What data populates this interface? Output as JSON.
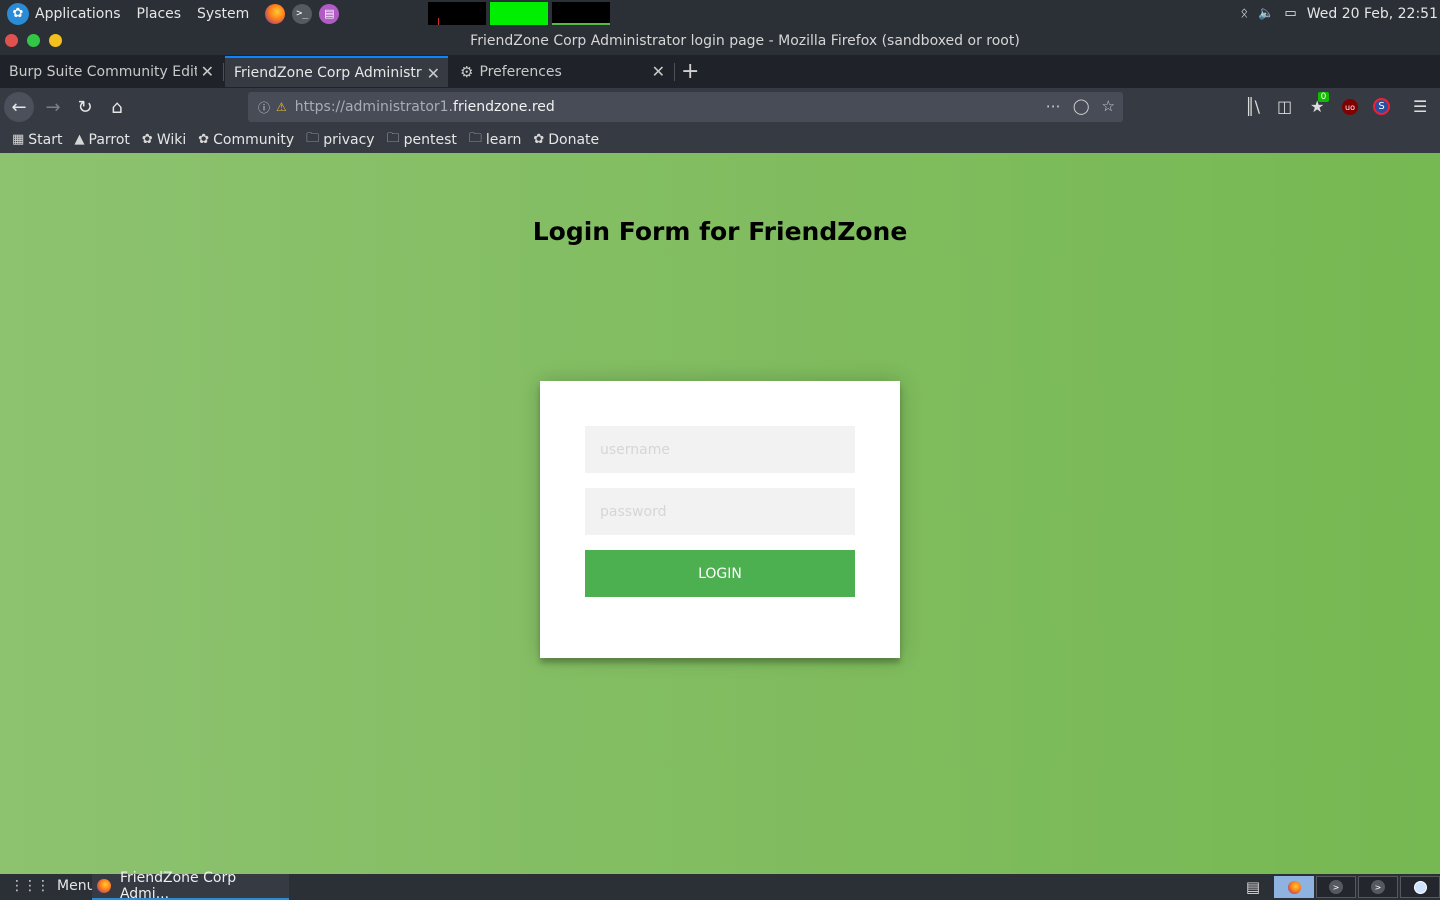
{
  "top_panel": {
    "menus": [
      "Applications",
      "Places",
      "System"
    ],
    "launchers": [
      "firefox-icon",
      "terminal-icon",
      "text-editor-icon"
    ],
    "clock": "Wed 20 Feb, 22:51",
    "tray_icons": [
      "bluetooth-icon",
      "volume-icon",
      "screen-icon"
    ]
  },
  "window": {
    "title": "FriendZone Corp Administrator login page - Mozilla Firefox (sandboxed or root)"
  },
  "tabs": [
    {
      "label": "Burp Suite Community Edition",
      "active": false
    },
    {
      "label": "FriendZone Corp Administrator login page",
      "active": true
    },
    {
      "label": "Preferences",
      "active": false,
      "icon": "gear-icon"
    }
  ],
  "navbar": {
    "url_prefix": "https://administrator1.",
    "url_domain": "friendzone.red"
  },
  "toolbar": {
    "badge_count": "0",
    "ublock_label": "uo",
    "s_label": "S"
  },
  "bookmarks": [
    {
      "label": "Start",
      "icon": "start-icon"
    },
    {
      "label": "Parrot",
      "icon": "parrot-icon"
    },
    {
      "label": "Wiki",
      "icon": "bookmark-icon"
    },
    {
      "label": "Community",
      "icon": "bookmark-icon"
    },
    {
      "label": "privacy",
      "icon": "folder-icon"
    },
    {
      "label": "pentest",
      "icon": "folder-icon"
    },
    {
      "label": "learn",
      "icon": "folder-icon"
    },
    {
      "label": "Donate",
      "icon": "bookmark-icon"
    }
  ],
  "page": {
    "heading": "Login Form for FriendZone",
    "username_placeholder": "username",
    "password_placeholder": "password",
    "login_label": "LOGIN"
  },
  "taskbar": {
    "menu_label": "Menu",
    "task_label": "FriendZone Corp Admi..."
  },
  "colors": {
    "page_gradient_start": "#8dc26f",
    "page_gradient_end": "#76b852",
    "login_button": "#4caf50",
    "active_tab_accent": "#0a84ff"
  }
}
